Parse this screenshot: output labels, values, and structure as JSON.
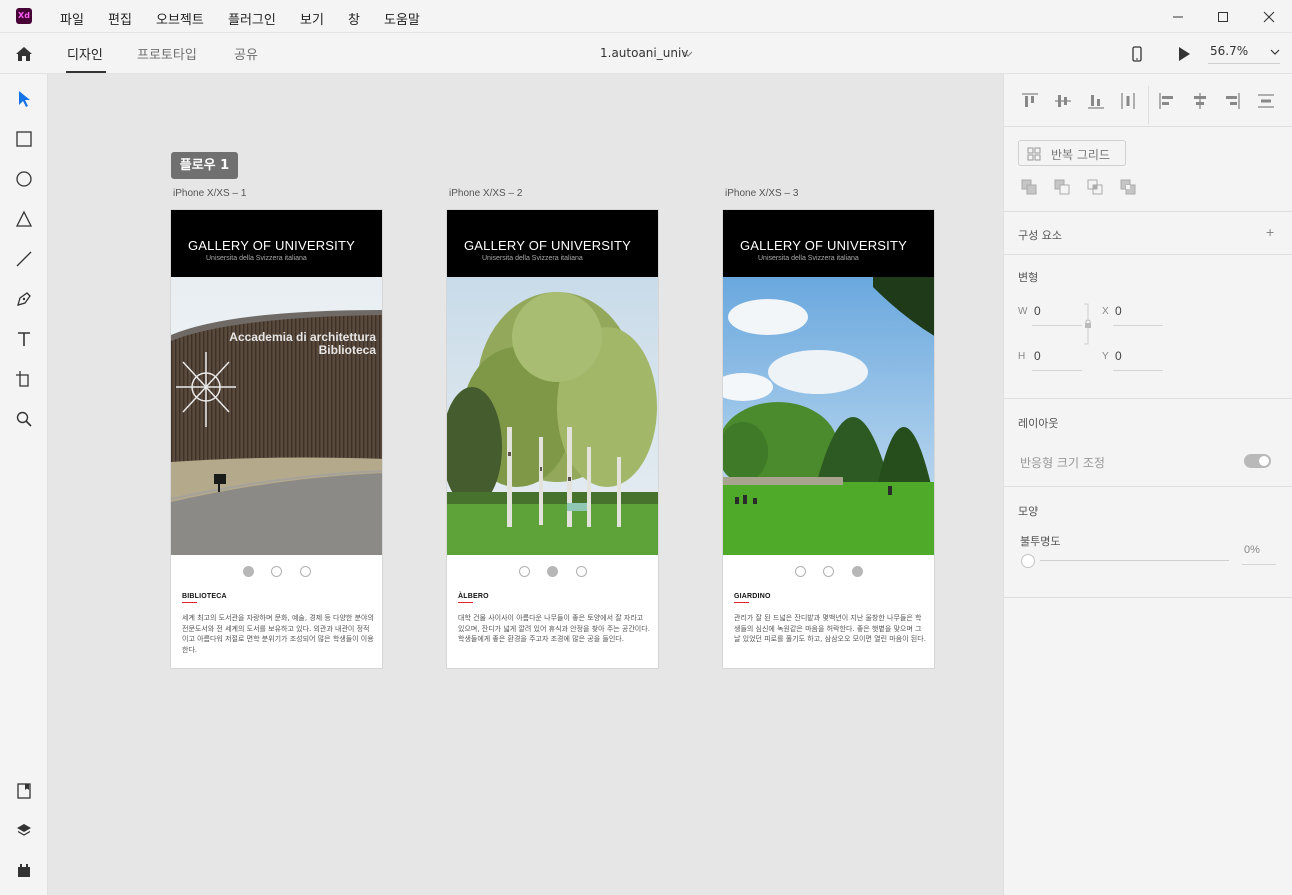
{
  "app": {
    "logo_text": "Xd"
  },
  "menu": [
    "파일",
    "편집",
    "오브젝트",
    "플러그인",
    "보기",
    "창",
    "도움말"
  ],
  "modes": {
    "design": "디자인",
    "prototype": "프로토타입",
    "share": "공유"
  },
  "document": {
    "title": "1.autoani_univ"
  },
  "zoom": {
    "value": "56.7%"
  },
  "canvas": {
    "flow_label": "플로우 1",
    "artboards": [
      {
        "label": "iPhone X/XS – 1",
        "title": "GALLERY OF UNIVERSITY",
        "subtitle": "Unisersita della Svizzera italiana",
        "active_dot": 0,
        "caption": "BIBLIOTECA",
        "description": "세계 최고의 도서관을 자랑하며 문화, 예술, 경제 등 다양한 분야의 전문도서와 전 세계의 도서를 보유하고 있다. 외관과 내관이 정적이고 아름다워 저절로 면학 분위기가 조성되어 많은 학생들이 이용한다.",
        "image_text_1": "Accademia di architettura",
        "image_text_2": "Biblioteca"
      },
      {
        "label": "iPhone X/XS – 2",
        "title": "GALLERY OF UNIVERSITY",
        "subtitle": "Unisersita della Svizzera italiana",
        "active_dot": 1,
        "caption": "ÀLBERO",
        "description": "대학 건물 사이사이 아름다운 나무들이 좋은 토양에서 잘 자라고 있으며, 잔디가 넓게 깔려 있어 휴식과 안정을 찾아 주는 공간이다. 학생들에게 좋은 환경을 주고자 조경에 많은 공을 들인다."
      },
      {
        "label": "iPhone X/XS – 3",
        "title": "GALLERY OF UNIVERSITY",
        "subtitle": "Unisersita della Svizzera italiana",
        "active_dot": 2,
        "caption": "GIARDINO",
        "description": "관리가 잘 된 드넓은 잔디밭과 몇백년이 지난 울창한 나무들은 학생들의 심신에 녹원같은 마음을 허락한다. 좋은 햇볕을 맞으며 그날 있었던 피로를 풀기도 하고, 삼삼오오 모이면 열린 마음이 된다."
      }
    ]
  },
  "panel": {
    "repeat_grid": "반복 그리드",
    "components": "구성 요소",
    "components_add": "+",
    "transform": "변형",
    "w_label": "W",
    "w_value": "0",
    "x_label": "X",
    "x_value": "0",
    "h_label": "H",
    "h_value": "0",
    "y_label": "Y",
    "y_value": "0",
    "layout": "레이아웃",
    "responsive_resize": "반응형 크기 조정",
    "appearance": "모양",
    "opacity_label": "불투명도",
    "opacity_value": "0%"
  },
  "colors": {
    "accent": "#1473e6",
    "logo_bg": "#470137",
    "logo_fg": "#ff61f6",
    "caption_underline": "#e3262d"
  }
}
